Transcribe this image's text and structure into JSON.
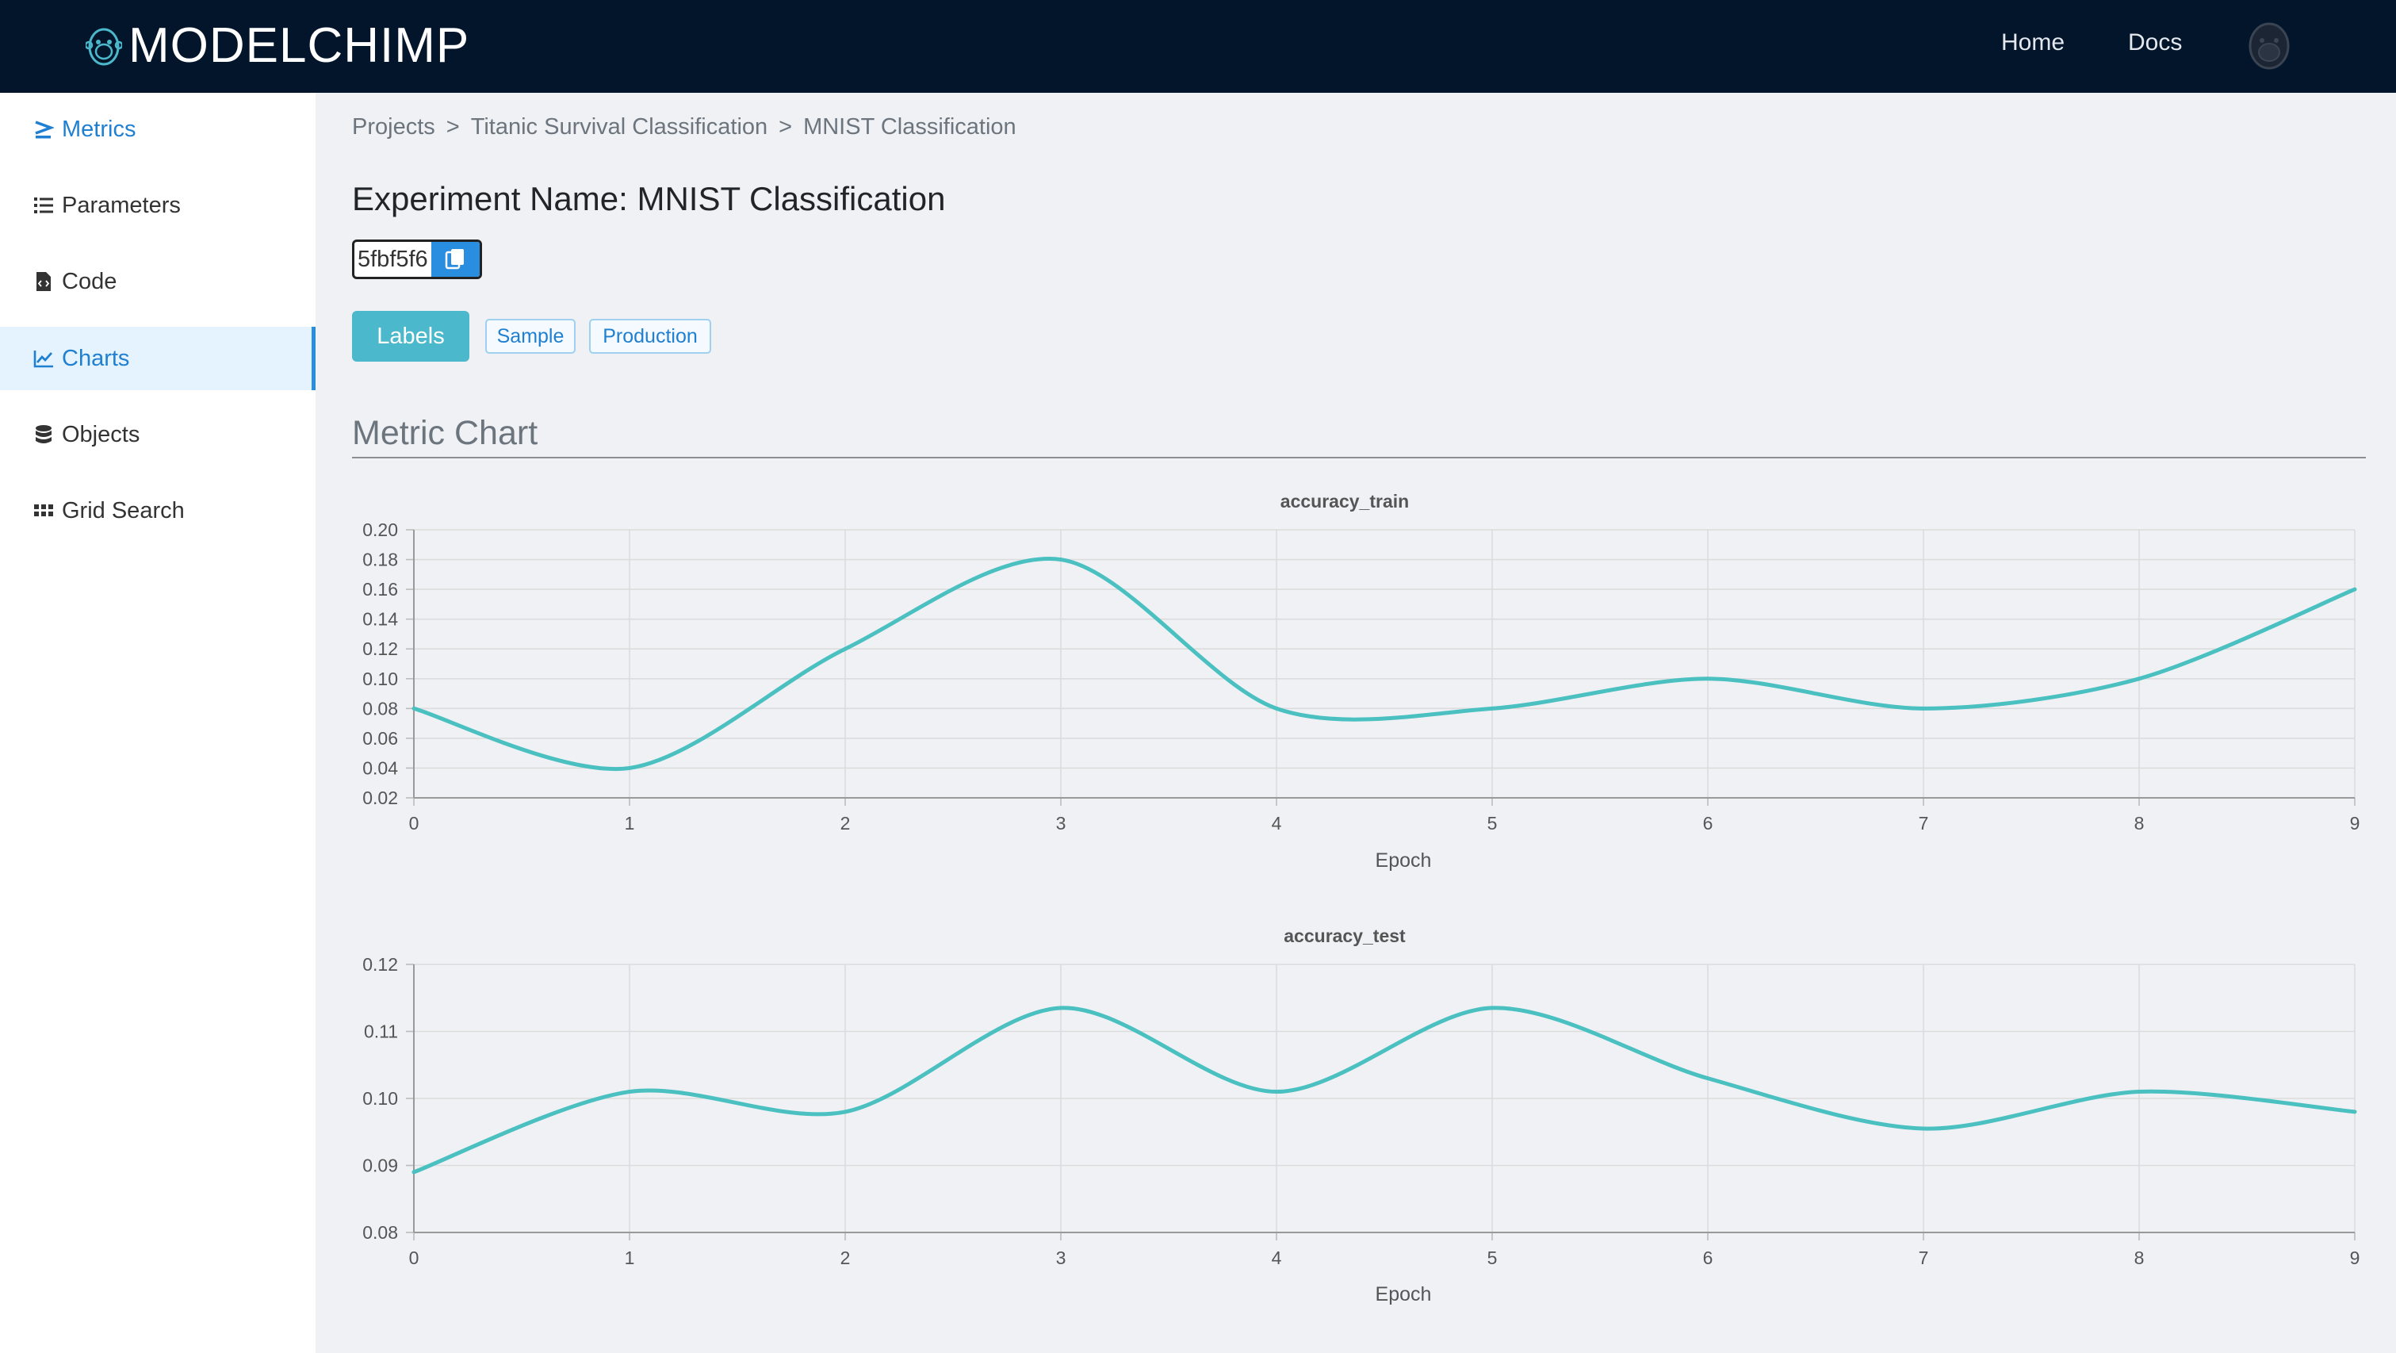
{
  "navbar": {
    "brand": "MODELCHIMP",
    "links": [
      "Home",
      "Docs"
    ],
    "background": "#02152a"
  },
  "sidebar": {
    "items": [
      {
        "label": "Metrics",
        "icon": "sigma-icon"
      },
      {
        "label": "Parameters",
        "icon": "list-icon"
      },
      {
        "label": "Code",
        "icon": "code-file-icon"
      },
      {
        "label": "Charts",
        "icon": "line-chart-icon",
        "active": true
      },
      {
        "label": "Objects",
        "icon": "database-icon"
      },
      {
        "label": "Grid Search",
        "icon": "grid-icon"
      }
    ],
    "active_color": "#1f7fd1"
  },
  "breadcrumb": {
    "items": [
      "Projects",
      "Titanic Survival Classification",
      "MNIST Classification"
    ],
    "separator": ">"
  },
  "experiment": {
    "title": "Experiment Name: MNIST Classification",
    "hash": "5fbf5f6"
  },
  "labels": {
    "button": "Labels",
    "tags": [
      "Sample",
      "Production"
    ]
  },
  "section": {
    "title": "Metric Chart"
  },
  "chart_data": [
    {
      "type": "line",
      "title": "accuracy_train",
      "xlabel": "Epoch",
      "ylabel": "",
      "x": [
        0,
        1,
        2,
        3,
        4,
        5,
        6,
        7,
        8,
        9
      ],
      "ylim": [
        0.02,
        0.2
      ],
      "yticks": [
        "0.20",
        "0.18",
        "0.16",
        "0.14",
        "0.12",
        "0.10",
        "0.08",
        "0.06",
        "0.04",
        "0.02"
      ],
      "series": [
        {
          "values": [
            0.08,
            0.04,
            0.12,
            0.18,
            0.08,
            0.08,
            0.1,
            0.08,
            0.1,
            0.16
          ],
          "color": "#4bc0c0"
        }
      ],
      "grid": true
    },
    {
      "type": "line",
      "title": "accuracy_test",
      "xlabel": "Epoch",
      "ylabel": "",
      "x": [
        0,
        1,
        2,
        3,
        4,
        5,
        6,
        7,
        8,
        9
      ],
      "ylim": [
        0.08,
        0.12
      ],
      "yticks": [
        "0.12",
        "0.11",
        "0.10",
        "0.09",
        "0.08"
      ],
      "series": [
        {
          "values": [
            0.089,
            0.101,
            0.098,
            0.1135,
            0.101,
            0.1135,
            0.103,
            0.0955,
            0.101,
            0.098
          ],
          "color": "#4bc0c0"
        }
      ],
      "grid": true
    }
  ]
}
